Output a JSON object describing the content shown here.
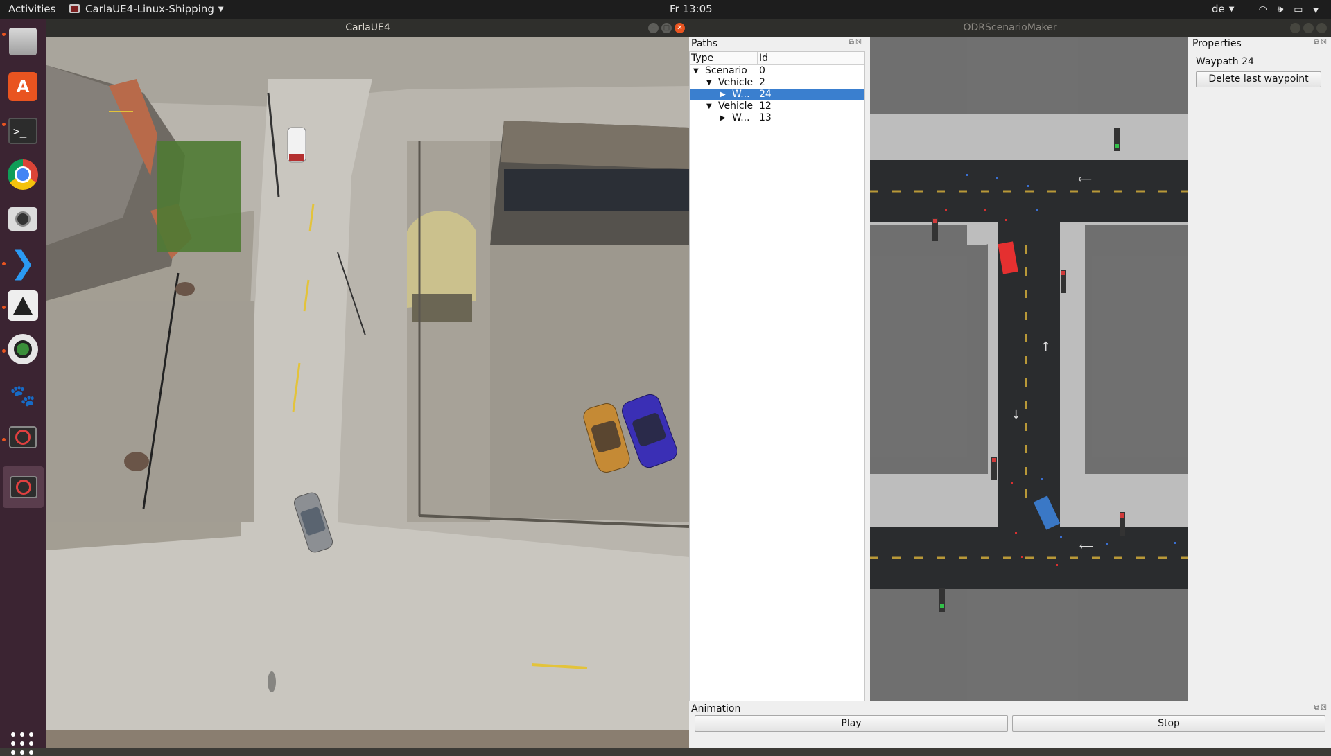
{
  "topbar": {
    "activities": "Activities",
    "app_name": "CarlaUE4-Linux-Shipping",
    "clock": "Fr 13:05",
    "language": "de"
  },
  "dock": {
    "items": [
      "files",
      "software",
      "terminal",
      "chrome",
      "camera",
      "vscode",
      "inkscape",
      "eye",
      "gimp",
      "blocked-app",
      "blocked-app-active"
    ]
  },
  "carla": {
    "title": "CarlaUE4"
  },
  "odr": {
    "title": "ODRScenarioMaker",
    "paths": {
      "title": "Paths",
      "columns": [
        "Type",
        "Id"
      ],
      "rows": [
        {
          "type": "Scenario",
          "id": "0",
          "level": 0,
          "expanded": true
        },
        {
          "type": "Vehicle",
          "id": "2",
          "level": 1,
          "expanded": true
        },
        {
          "type": "W...",
          "id": "24",
          "level": 2,
          "expanded": false,
          "selected": true
        },
        {
          "type": "Vehicle",
          "id": "12",
          "level": 1,
          "expanded": true
        },
        {
          "type": "W...",
          "id": "13",
          "level": 2,
          "expanded": false
        }
      ]
    },
    "properties": {
      "title": "Properties",
      "subtitle": "Waypath 24",
      "delete_label": "Delete last waypoint"
    },
    "animation": {
      "title": "Animation",
      "play_label": "Play",
      "stop_label": "Stop"
    }
  },
  "colors": {
    "selection": "#3a7fcf",
    "ubuntu_orange": "#e95420",
    "vehicle_red": "#e53030",
    "vehicle_blue": "#3a78c6"
  }
}
